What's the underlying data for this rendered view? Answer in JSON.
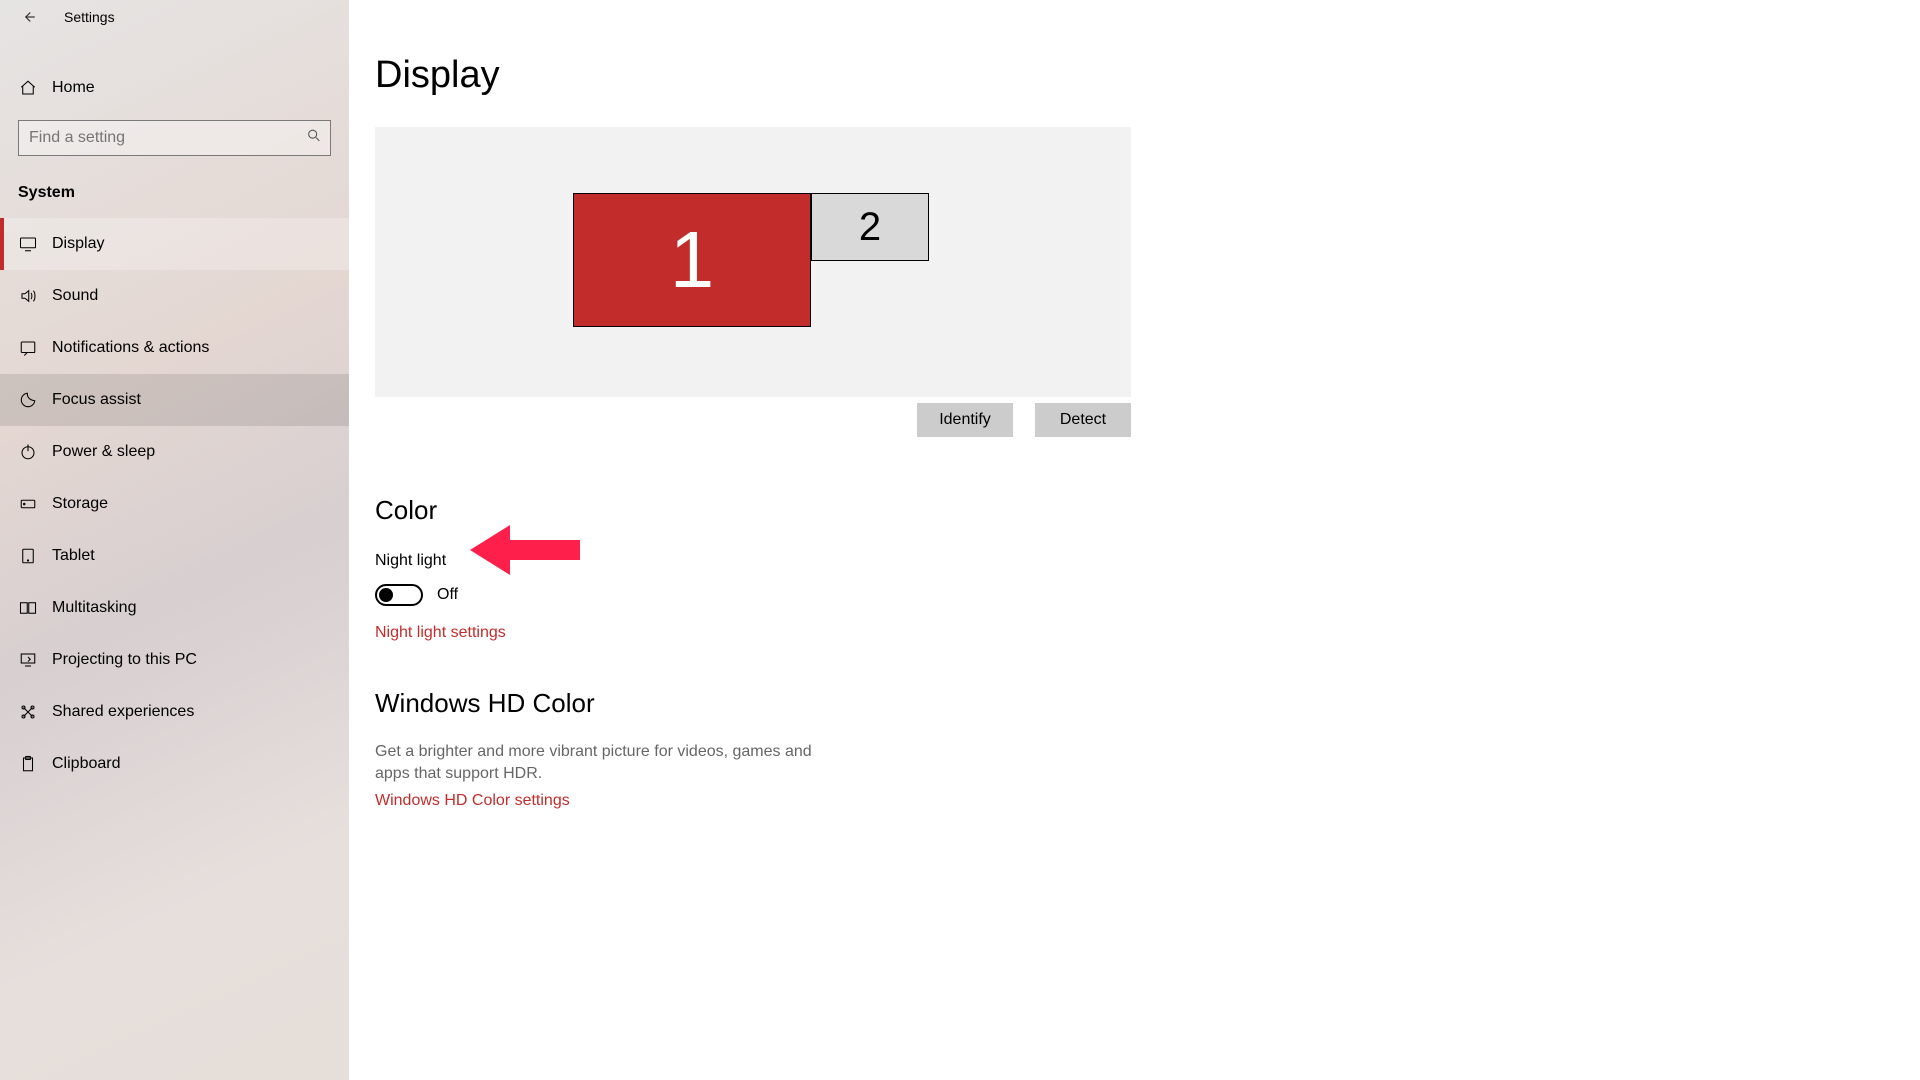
{
  "app": {
    "title": "Settings"
  },
  "sidebar": {
    "home": "Home",
    "search_placeholder": "Find a setting",
    "section": "System",
    "items": [
      {
        "id": "display",
        "label": "Display",
        "selected": true
      },
      {
        "id": "sound",
        "label": "Sound"
      },
      {
        "id": "notifications",
        "label": "Notifications & actions"
      },
      {
        "id": "focus",
        "label": "Focus assist",
        "hover": true
      },
      {
        "id": "power",
        "label": "Power & sleep"
      },
      {
        "id": "storage",
        "label": "Storage"
      },
      {
        "id": "tablet",
        "label": "Tablet"
      },
      {
        "id": "multitask",
        "label": "Multitasking"
      },
      {
        "id": "projecting",
        "label": "Projecting to this PC"
      },
      {
        "id": "shared",
        "label": "Shared experiences"
      },
      {
        "id": "clipboard",
        "label": "Clipboard"
      }
    ]
  },
  "page": {
    "title": "Display",
    "monitors": {
      "primary": "1",
      "secondary": "2"
    },
    "buttons": {
      "identify": "Identify",
      "detect": "Detect"
    },
    "color": {
      "heading": "Color",
      "night_light_label": "Night light",
      "night_light_state": "Off",
      "night_light_link": "Night light settings"
    },
    "hdr": {
      "heading": "Windows HD Color",
      "desc": "Get a brighter and more vibrant picture for videos, games and apps that support HDR.",
      "link": "Windows HD Color settings"
    }
  },
  "accent": "#c22d2b"
}
